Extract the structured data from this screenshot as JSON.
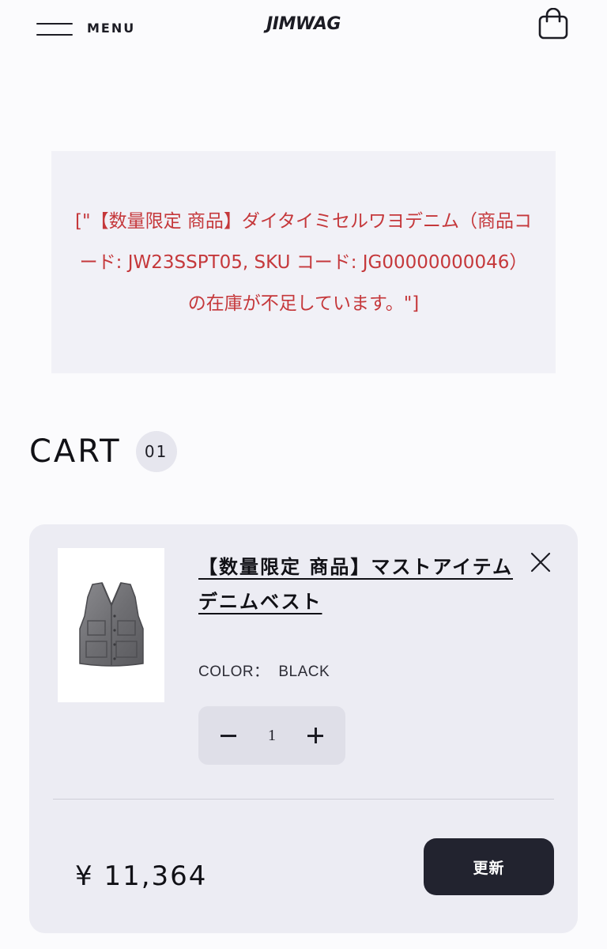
{
  "header": {
    "menu_label": "MENU",
    "logo_text": "JIMWAG"
  },
  "alert": {
    "message": "[\"【数量限定 商品】ダイタイミセルワヨデニム（商品コード: JW23SSPT05, SKU コード: JG00000000046）の在庫が不足しています。\"]",
    "color": "#c5383b"
  },
  "cart": {
    "title": "CART",
    "count": "01",
    "items": [
      {
        "name": "【数量限定 商品】マストアイテムデニムベスト",
        "color_label": "COLOR：",
        "color_value": "BLACK",
        "quantity": "1",
        "price": "¥ 11,364",
        "update_label": "更新"
      }
    ]
  },
  "icons": {
    "menu": "hamburger-icon",
    "cart": "shopping-bag-icon",
    "remove": "close-icon",
    "decrease": "minus-icon",
    "increase": "plus-icon"
  },
  "colors": {
    "background": "#fbfbfd",
    "card": "#ececf3",
    "button": "#22232f"
  }
}
